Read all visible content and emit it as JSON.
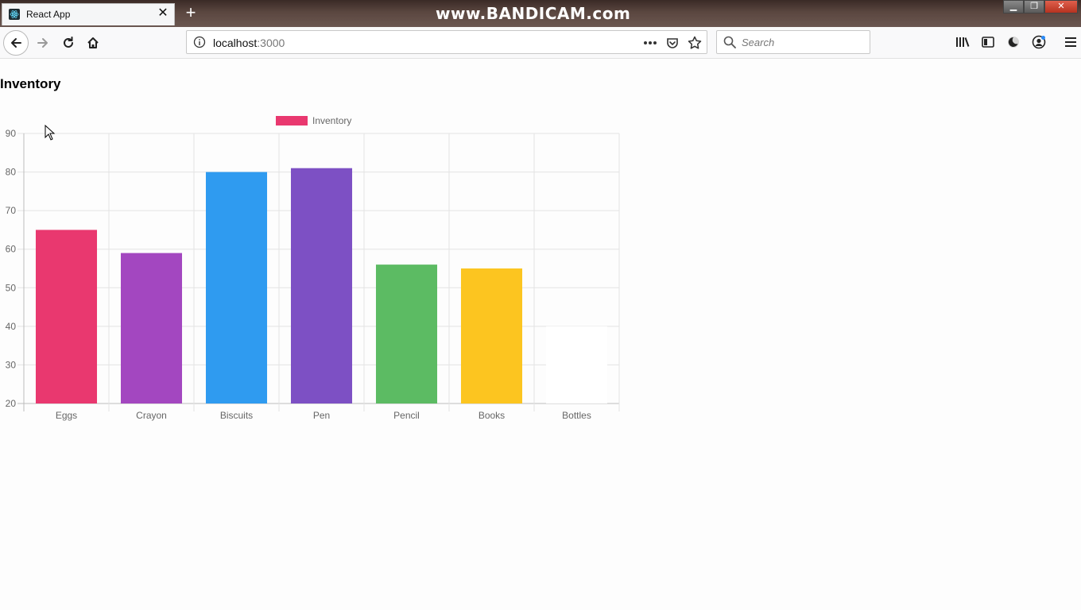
{
  "browser": {
    "tab": {
      "title": "React App"
    },
    "watermark": "www.BANDICAM.com",
    "url": {
      "host": "localhost",
      "port": ":3000"
    },
    "search_placeholder": "Search",
    "icons": [
      "back-icon",
      "forward-icon",
      "reload-icon",
      "home-icon",
      "page-info-icon",
      "more-icon",
      "pocket-icon",
      "bookmark-star-icon",
      "search-icon",
      "library-icon",
      "sidebar-icon",
      "dark-mode-icon",
      "account-icon",
      "menu-icon"
    ]
  },
  "page": {
    "title": "Inventory"
  },
  "chart_data": {
    "type": "bar",
    "title": "",
    "legend": {
      "position": "top",
      "entries": [
        "Inventory"
      ]
    },
    "categories": [
      "Eggs",
      "Crayon",
      "Biscuits",
      "Pen",
      "Pencil",
      "Books",
      "Bottles"
    ],
    "series": [
      {
        "name": "Inventory",
        "values": [
          65,
          59,
          80,
          81,
          56,
          55,
          40
        ]
      }
    ],
    "colors": [
      "#e9386f",
      "#a347c0",
      "#2f9bf0",
      "#7d50c4",
      "#5cbb63",
      "#fcc520",
      "#ffffff"
    ],
    "yticks": [
      20,
      30,
      40,
      50,
      60,
      70,
      80,
      90
    ],
    "ylim": [
      20,
      90
    ],
    "grid": true,
    "xlabel": "",
    "ylabel": ""
  }
}
